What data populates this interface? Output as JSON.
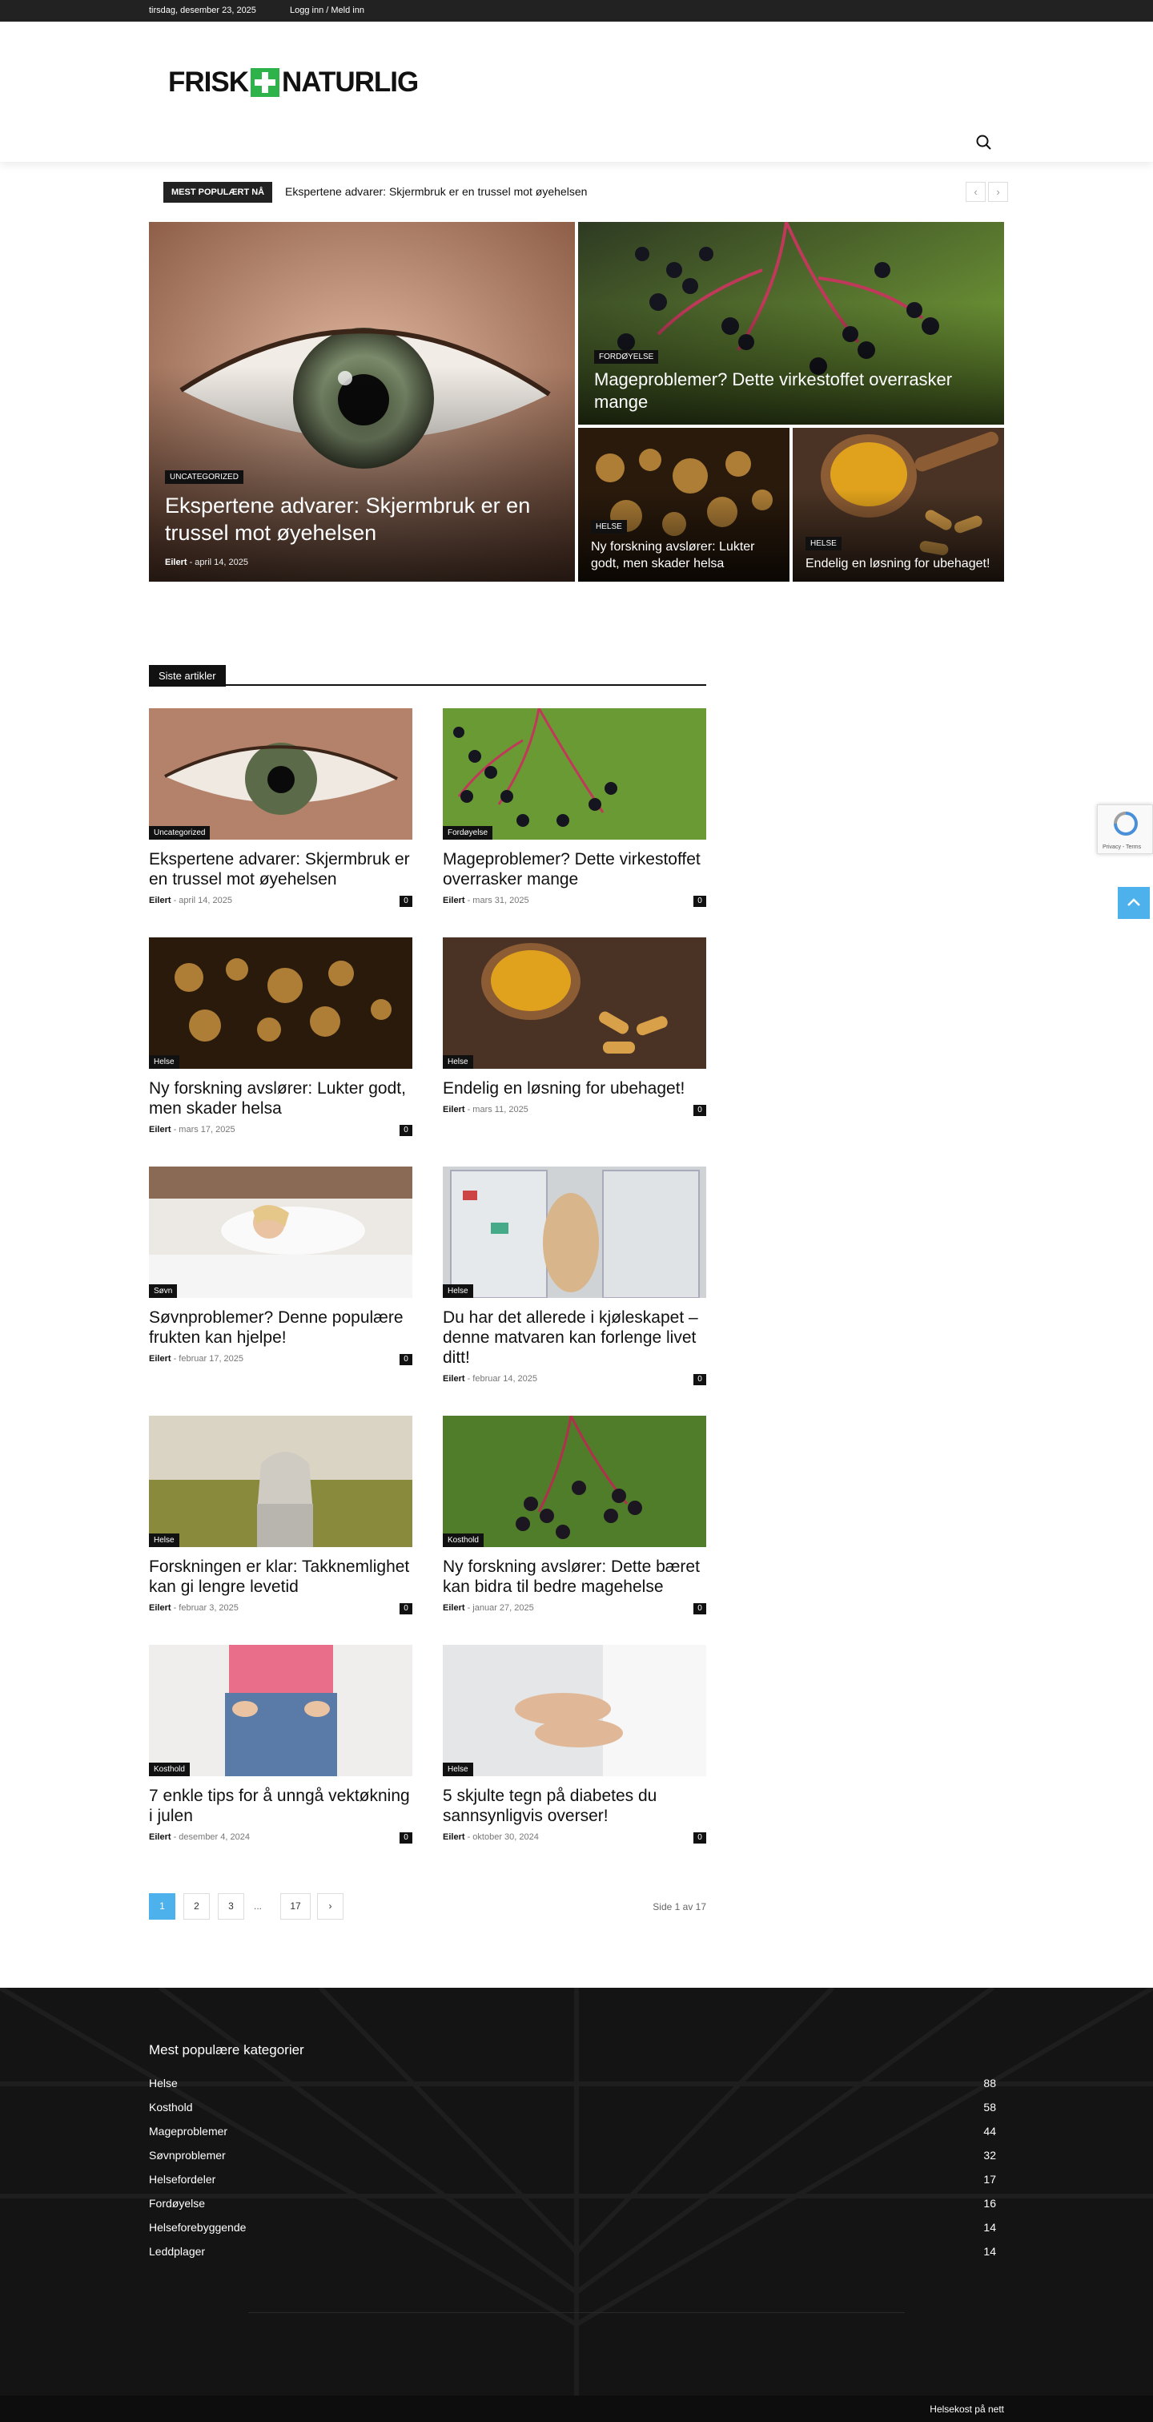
{
  "topbar": {
    "date": "tirsdag, desember 23, 2025",
    "login": "Logg inn / Meld inn"
  },
  "logo": {
    "left": "FRISK",
    "right": "NATURLIG",
    "accent": "#2db34a"
  },
  "header": {
    "search_icon": "search-icon"
  },
  "ticker": {
    "label": "MEST POPULÆRT NÅ",
    "text": "Ekspertene advarer: Skjermbruk er en trussel mot øyehelsen",
    "prev": "‹",
    "next": "›"
  },
  "hero": [
    {
      "category": "UNCATEGORIZED",
      "title": "Ekspertene advarer: Skjermbruk er en trussel mot øyehelsen",
      "author": "Eilert",
      "date": "april 14, 2025"
    },
    {
      "category": "FORDØYELSE",
      "title": "Mageproblemer? Dette virkestoffet overrasker mange"
    },
    {
      "category": "HELSE",
      "title": "Ny forskning avslører: Lukter godt, men skader helsa"
    },
    {
      "category": "HELSE",
      "title": "Endelig en løsning for ubehaget!"
    }
  ],
  "latest": {
    "heading": "Siste artikler",
    "articles": [
      {
        "category": "Uncategorized",
        "title": "Ekspertene advarer: Skjermbruk er en trussel mot øyehelsen",
        "author": "Eilert",
        "date": "april 14, 2025",
        "comments": "0"
      },
      {
        "category": "Fordøyelse",
        "title": "Mageproblemer? Dette virkestoffet overrasker mange",
        "author": "Eilert",
        "date": "mars 31, 2025",
        "comments": "0"
      },
      {
        "category": "Helse",
        "title": "Ny forskning avslører: Lukter godt, men skader helsa",
        "author": "Eilert",
        "date": "mars 17, 2025",
        "comments": "0"
      },
      {
        "category": "Helse",
        "title": "Endelig en løsning for ubehaget!",
        "author": "Eilert",
        "date": "mars 11, 2025",
        "comments": "0"
      },
      {
        "category": "Søvn",
        "title": "Søvnproblemer? Denne populære frukten kan hjelpe!",
        "author": "Eilert",
        "date": "februar 17, 2025",
        "comments": "0"
      },
      {
        "category": "Helse",
        "title": "Du har det allerede i kjøleskapet – denne matvaren kan forlenge livet ditt!",
        "author": "Eilert",
        "date": "februar 14, 2025",
        "comments": "0"
      },
      {
        "category": "Helse",
        "title": "Forskningen er klar: Takknemlighet kan gi lengre levetid",
        "author": "Eilert",
        "date": "februar 3, 2025",
        "comments": "0"
      },
      {
        "category": "Kosthold",
        "title": "Ny forskning avslører: Dette bæret kan bidra til bedre magehelse",
        "author": "Eilert",
        "date": "januar 27, 2025",
        "comments": "0"
      },
      {
        "category": "Kosthold",
        "title": "7 enkle tips for å unngå vektøkning i julen",
        "author": "Eilert",
        "date": "desember 4, 2024",
        "comments": "0"
      },
      {
        "category": "Helse",
        "title": "5 skjulte tegn på diabetes du sannsynligvis overser!",
        "author": "Eilert",
        "date": "oktober 30, 2024",
        "comments": "0"
      }
    ]
  },
  "pagination": {
    "pages": [
      "1",
      "2",
      "3"
    ],
    "dots": "...",
    "last": "17",
    "next": "›",
    "status": "Side 1 av 17",
    "active_color": "#4db2ec"
  },
  "footer": {
    "title": "Mest populære kategorier",
    "categories": [
      {
        "name": "Helse",
        "count": "88"
      },
      {
        "name": "Kosthold",
        "count": "58"
      },
      {
        "name": "Mageproblemer",
        "count": "44"
      },
      {
        "name": "Søvnproblemer",
        "count": "32"
      },
      {
        "name": "Helsefordeler",
        "count": "17"
      },
      {
        "name": "Fordøyelse",
        "count": "16"
      },
      {
        "name": "Helseforebyggende",
        "count": "14"
      },
      {
        "name": "Leddplager",
        "count": "14"
      }
    ],
    "bottom_link": "Helsekost på nett"
  },
  "recaptcha": {
    "text": "Privacy - Terms"
  }
}
